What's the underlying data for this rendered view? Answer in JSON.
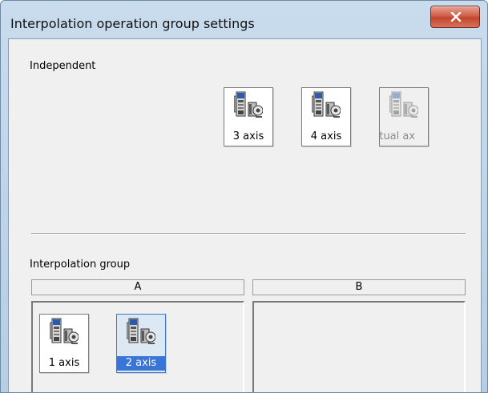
{
  "window": {
    "title": "Interpolation operation group settings",
    "close_label": "x"
  },
  "independent": {
    "label": "Independent",
    "axes": [
      {
        "label": "3 axis",
        "state": "normal"
      },
      {
        "label": "4 axis",
        "state": "normal"
      },
      {
        "label": "rtual ax",
        "state": "disabled"
      }
    ]
  },
  "interpolation": {
    "label": "Interpolation group",
    "groups": [
      {
        "name": "A",
        "axes": [
          {
            "label": "1 axis",
            "state": "normal"
          },
          {
            "label": "2 axis",
            "state": "selected"
          }
        ]
      },
      {
        "name": "B",
        "axes": []
      }
    ]
  },
  "colors": {
    "selection": "#3875d7",
    "close_button": "#c1442d",
    "dialog_bg": "#f0f0f0"
  },
  "icons": {
    "axis_icon": "servo-amplifier-motor-icon",
    "close_icon": "x-icon"
  }
}
